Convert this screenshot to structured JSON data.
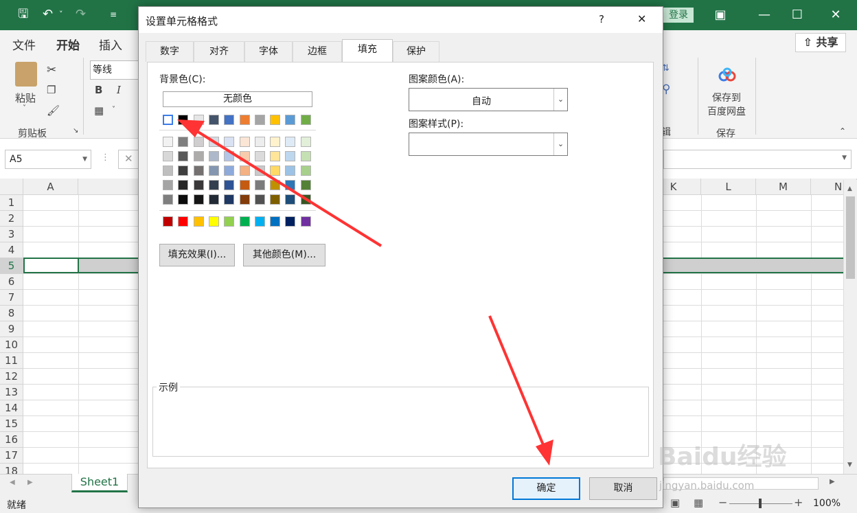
{
  "titlebar": {
    "login": "登录"
  },
  "menu": {
    "file": "文件",
    "home": "开始",
    "insert": "插入",
    "share": "共享"
  },
  "ribbon": {
    "paste": "粘贴",
    "clipboard": "剪贴板",
    "font_name": "等线",
    "bold": "B",
    "italic": "I",
    "save_to_line1": "保存到",
    "save_to_line2": "百度网盘",
    "save_group": "保存",
    "group_e": "辑"
  },
  "formula": {
    "name_box": "A5"
  },
  "columns": [
    "A",
    "K",
    "L",
    "M",
    "N"
  ],
  "rows": [
    "1",
    "2",
    "3",
    "4",
    "5",
    "6",
    "7",
    "8",
    "9",
    "10",
    "11",
    "12",
    "13",
    "14",
    "15",
    "16",
    "17",
    "18"
  ],
  "sheet": {
    "tab": "Sheet1"
  },
  "status": {
    "ready": "就绪",
    "zoom": "100%"
  },
  "dialog": {
    "title": "设置单元格格式",
    "help": "?",
    "close": "✕",
    "tabs": [
      "数字",
      "对齐",
      "字体",
      "边框",
      "填充",
      "保护"
    ],
    "active_tab": "填充",
    "bg_color_label": "背景色(C):",
    "no_color": "无颜色",
    "fill_effects": "填充效果(I)...",
    "more_colors": "其他颜色(M)...",
    "pattern_color_label": "图案颜色(A):",
    "pattern_color_value": "自动",
    "pattern_style_label": "图案样式(P):",
    "sample_label": "示例",
    "ok": "确定",
    "cancel": "取消"
  },
  "palette": {
    "theme_row": [
      "#ffffff",
      "#000000",
      "#e7e6e6",
      "#44546a",
      "#4472c4",
      "#ed7d31",
      "#a5a5a5",
      "#ffc000",
      "#5b9bd5",
      "#70ad47"
    ],
    "tints": [
      [
        "#f2f2f2",
        "#7f7f7f",
        "#d0cece",
        "#d6dce4",
        "#d9e2f3",
        "#fbe5d5",
        "#ededed",
        "#fff2cc",
        "#deebf6",
        "#e2efd9"
      ],
      [
        "#d8d8d8",
        "#595959",
        "#aeabab",
        "#adb9ca",
        "#b4c6e7",
        "#f7cbac",
        "#dbdbdb",
        "#fee599",
        "#bdd7ee",
        "#c5e0b3"
      ],
      [
        "#bfbfbf",
        "#3f3f3f",
        "#757171",
        "#8496b0",
        "#8eaadb",
        "#f4b183",
        "#c9c9c9",
        "#ffd965",
        "#9cc3e5",
        "#a8d08d"
      ],
      [
        "#a5a5a5",
        "#262626",
        "#3a3838",
        "#323f4f",
        "#2f5496",
        "#c55a11",
        "#7b7b7b",
        "#bf9000",
        "#2e75b5",
        "#538135"
      ],
      [
        "#7f7f7f",
        "#0c0c0c",
        "#171616",
        "#222a35",
        "#1f3864",
        "#833c0b",
        "#525252",
        "#7f6000",
        "#1e4e79",
        "#375623"
      ]
    ],
    "standard": [
      "#c00000",
      "#ff0000",
      "#ffc000",
      "#ffff00",
      "#92d050",
      "#00b050",
      "#00b0f0",
      "#0070c0",
      "#002060",
      "#7030a0"
    ]
  },
  "annotation": {
    "arrow_color": "#ff3333"
  },
  "watermark": {
    "brand": "Baidu经验",
    "url": "jingyan.baidu.com"
  }
}
